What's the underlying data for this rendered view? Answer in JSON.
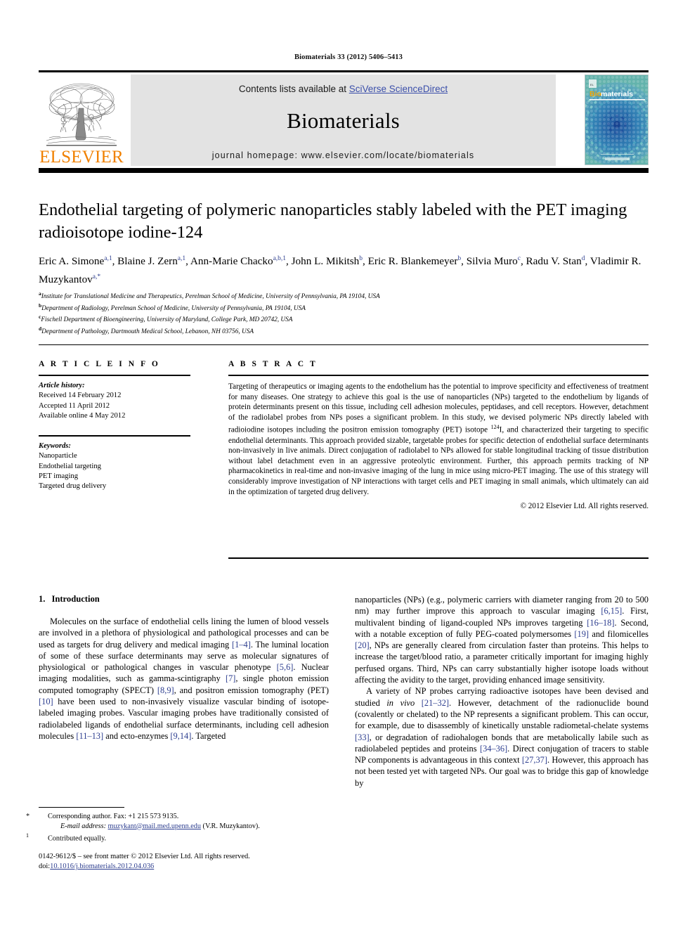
{
  "running_head": "Biomaterials 33 (2012) 5406–5413",
  "masthead": {
    "contents_prefix": "Contents lists available at ",
    "sciencedirect_link": "SciVerse ScienceDirect",
    "journal_name": "Biomaterials",
    "homepage_label": "journal homepage: www.elsevier.com/locate/biomaterials",
    "publisher_wordmark": "ELSEVIER",
    "cover_title_a": "Bio",
    "cover_title_b": "materials"
  },
  "article": {
    "title": "Endothelial targeting of polymeric nanoparticles stably labeled with the PET imaging radioisotope iodine-124",
    "authors": [
      {
        "name": "Eric A. Simone",
        "sup": "a,1",
        "sep": ", "
      },
      {
        "name": "Blaine J. Zern",
        "sup": "a,1",
        "sep": ", "
      },
      {
        "name": "Ann-Marie Chacko",
        "sup": "a,b,1",
        "sep": ", "
      },
      {
        "name": "John L. Mikitsh",
        "sup": "b",
        "sep": ", "
      },
      {
        "name": "Eric R. Blankemeyer",
        "sup": "b",
        "sep": ", "
      },
      {
        "name": "Silvia Muro",
        "sup": "c",
        "sep": ", "
      },
      {
        "name": "Radu V. Stan",
        "sup": "d",
        "sep": ", "
      },
      {
        "name": "Vladimir R. Muzykantov",
        "sup": "a,*",
        "sep": ""
      }
    ],
    "affiliations": [
      {
        "mark": "a",
        "text": "Institute for Translational Medicine and Therapeutics, Perelman School of Medicine, University of Pennsylvania, PA 19104, USA"
      },
      {
        "mark": "b",
        "text": "Department of Radiology, Perelman School of Medicine, University of Pennsylvania, PA 19104, USA"
      },
      {
        "mark": "c",
        "text": "Fischell Department of Bioengineering, University of Maryland, College Park, MD 20742, USA"
      },
      {
        "mark": "d",
        "text": "Department of Pathology, Dartmouth Medical School, Lebanon, NH 03756, USA"
      }
    ]
  },
  "article_info": {
    "heading": "A R T I C L E  I N F O",
    "history_label": "Article history:",
    "history": [
      "Received 14 February 2012",
      "Accepted 11 April 2012",
      "Available online 4 May 2012"
    ],
    "keywords_label": "Keywords:",
    "keywords": [
      "Nanoparticle",
      "Endothelial targeting",
      "PET imaging",
      "Targeted drug delivery"
    ]
  },
  "abstract": {
    "heading": "A B S T R A C T",
    "part1": "Targeting of therapeutics or imaging agents to the endothelium has the potential to improve specificity and effectiveness of treatment for many diseases. One strategy to achieve this goal is the use of nanoparticles (NPs) targeted to the endothelium by ligands of protein determinants present on this tissue, including cell adhesion molecules, peptidases, and cell receptors. However, detachment of the radiolabel probes from NPs poses a significant problem. In this study, we devised polymeric NPs directly labeled with radioiodine isotopes including the positron emission tomography (PET) isotope ",
    "isotope_sup": "124",
    "isotope_sym": "I",
    "part2": ", and characterized their targeting to specific endothelial determinants. This approach provided sizable, targetable probes for specific detection of endothelial surface determinants non-invasively in live animals. Direct conjugation of radiolabel to NPs allowed for stable longitudinal tracking of tissue distribution without label detachment even in an aggressive proteolytic environment. Further, this approach permits tracking of NP pharmacokinetics in real-time and non-invasive imaging of the lung in mice using micro-PET imaging. The use of this strategy will considerably improve investigation of NP interactions with target cells and PET imaging in small animals, which ultimately can aid in the optimization of targeted drug delivery.",
    "copyright": "© 2012 Elsevier Ltd. All rights reserved."
  },
  "body": {
    "section_number": "1.",
    "section_title": "Introduction",
    "left_paragraph_1": [
      {
        "t": "Molecules on the surface of endothelial cells lining the lumen of blood vessels are involved in a plethora of physiological and pathological processes and can be used as targets for drug delivery and medical imaging "
      },
      {
        "t": "[1–4]",
        "k": "ref"
      },
      {
        "t": ". The luminal location of some of these surface determinants may serve as molecular signatures of physiological or pathological changes in vascular phenotype "
      },
      {
        "t": "[5,6]",
        "k": "ref"
      },
      {
        "t": ". Nuclear imaging modalities, such as gamma-scintigraphy "
      },
      {
        "t": "[7]",
        "k": "ref"
      },
      {
        "t": ", single photon emission computed tomography (SPECT) "
      },
      {
        "t": "[8,9]",
        "k": "ref"
      },
      {
        "t": ", and positron emission tomography (PET) "
      },
      {
        "t": "[10]",
        "k": "ref"
      },
      {
        "t": " have been used to non-invasively visualize vascular binding of isotope-labeled imaging probes. Vascular imaging probes have traditionally consisted of radiolabeled ligands of endothelial surface determinants, including cell adhesion molecules "
      },
      {
        "t": "[11–13]",
        "k": "ref"
      },
      {
        "t": " and ecto-enzymes "
      },
      {
        "t": "[9,14]",
        "k": "ref"
      },
      {
        "t": ". Targeted"
      }
    ],
    "right_paragraph_1": [
      {
        "t": "nanoparticles (NPs) (e.g., polymeric carriers with diameter ranging from 20 to 500 nm) may further improve this approach to vascular imaging "
      },
      {
        "t": "[6,15]",
        "k": "ref"
      },
      {
        "t": ". First, multivalent binding of ligand-coupled NPs improves targeting "
      },
      {
        "t": "[16–18]",
        "k": "ref"
      },
      {
        "t": ". Second, with a notable exception of fully PEG-coated polymersomes "
      },
      {
        "t": "[19]",
        "k": "ref"
      },
      {
        "t": " and filomicelles "
      },
      {
        "t": "[20]",
        "k": "ref"
      },
      {
        "t": ", NPs are generally cleared from circulation faster than proteins. This helps to increase the target/blood ratio, a parameter critically important for imaging highly perfused organs. Third, NPs can carry substantially higher isotope loads without affecting the avidity to the target, providing enhanced image sensitivity."
      }
    ],
    "right_paragraph_2": [
      {
        "t": "A variety of NP probes carrying radioactive isotopes have been devised and studied "
      },
      {
        "t": "in vivo",
        "k": "it"
      },
      {
        "t": " "
      },
      {
        "t": "[21–32]",
        "k": "ref"
      },
      {
        "t": ". However, detachment of the radionuclide bound (covalently or chelated) to the NP represents a significant problem. This can occur, for example, due to disassembly of kinetically unstable radiometal-chelate systems "
      },
      {
        "t": "[33]",
        "k": "ref"
      },
      {
        "t": ", or degradation of radiohalogen bonds that are metabolically labile such as radiolabeled peptides and proteins "
      },
      {
        "t": "[34–36]",
        "k": "ref"
      },
      {
        "t": ". Direct conjugation of tracers to stable NP components is advantageous in this context "
      },
      {
        "t": "[27,37]",
        "k": "ref"
      },
      {
        "t": ". However, this approach has not been tested yet with targeted NPs. Our goal was to bridge this gap of knowledge by"
      }
    ]
  },
  "footnotes": {
    "corresponding_mark": "*",
    "corresponding_text": "Corresponding author. Fax: +1 215 573 9135.",
    "email_label": "E-mail address:",
    "email": "muzykant@mail.med.upenn.edu",
    "email_suffix": "(V.R. Muzykantov).",
    "equal_mark": "1",
    "equal_text": "Contributed equally.",
    "colophon_line1": "0142-9612/$ – see front matter © 2012 Elsevier Ltd. All rights reserved.",
    "colophon_doi_label": "doi:",
    "colophon_doi": "10.1016/j.biomaterials.2012.04.036"
  },
  "colors": {
    "link_blue": "#2d3e8f",
    "sciencedirect_blue": "#3b4faa",
    "elsevier_orange": "#F08000",
    "panel_gray": "#e3e3e3",
    "cover_teal": "#63b3ac"
  }
}
